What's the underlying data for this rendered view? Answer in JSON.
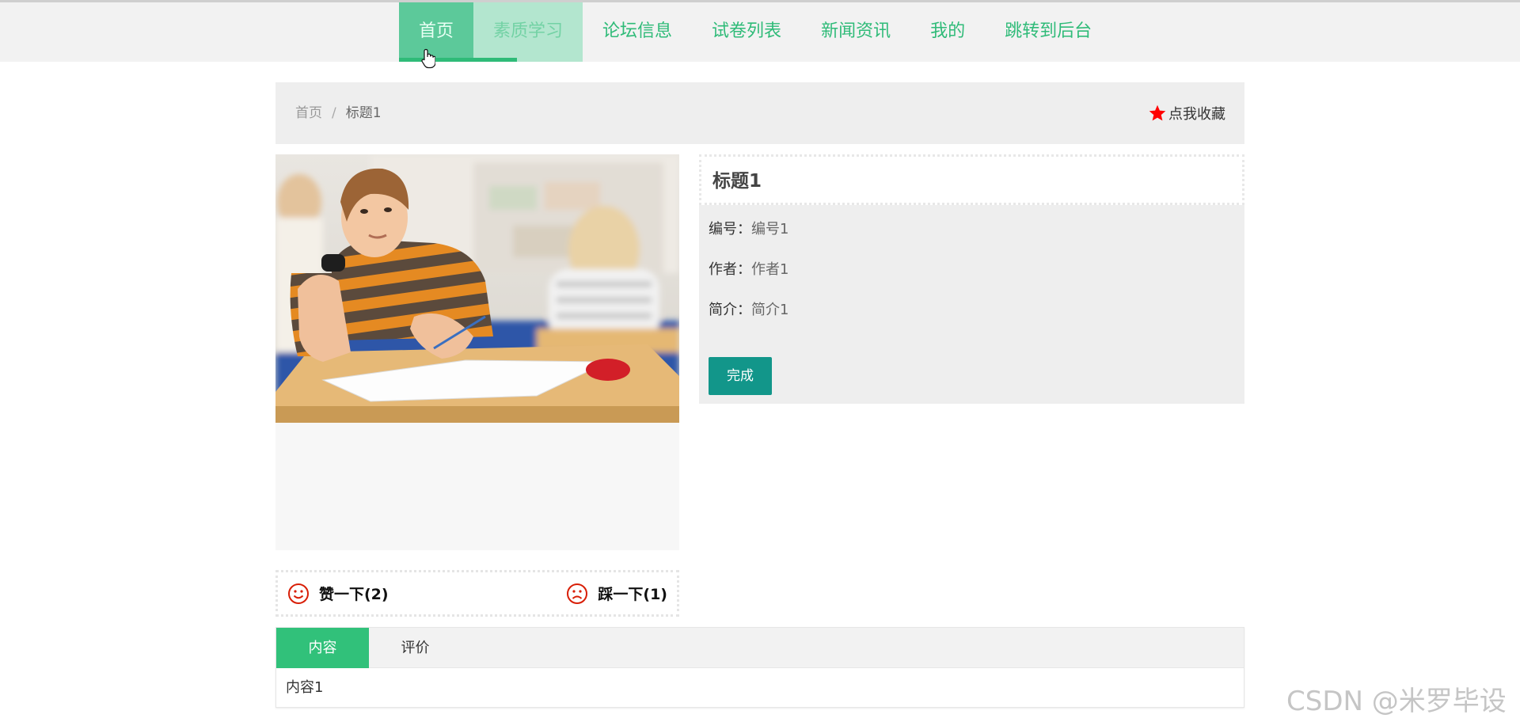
{
  "nav": {
    "items": [
      {
        "label": "首页"
      },
      {
        "label": "素质学习"
      },
      {
        "label": "论坛信息"
      },
      {
        "label": "试卷列表"
      },
      {
        "label": "新闻资讯"
      },
      {
        "label": "我的"
      },
      {
        "label": "跳转到后台"
      }
    ],
    "active_index": 0,
    "hover_index": 1
  },
  "breadcrumb": {
    "home": "首页",
    "separator": "/",
    "current": "标题1"
  },
  "favorite": {
    "icon": "star-icon",
    "label": "点我收藏",
    "color": "#ff0000"
  },
  "detail": {
    "title": "标题1",
    "fields": [
      {
        "label": "编号：",
        "value": "编号1"
      },
      {
        "label": "作者：",
        "value": "作者1"
      },
      {
        "label": "简介：",
        "value": "简介1"
      }
    ],
    "action_button": "完成"
  },
  "votes": {
    "up_label": "赞一下(2)",
    "down_label": "踩一下(1)",
    "icon_color": "#d81e06"
  },
  "tabs": {
    "items": [
      {
        "label": "内容"
      },
      {
        "label": "评价"
      }
    ],
    "content": "内容1"
  },
  "colors": {
    "accent": "#2fbb78",
    "button": "#12968a"
  },
  "watermark": "CSDN @米罗毕设"
}
